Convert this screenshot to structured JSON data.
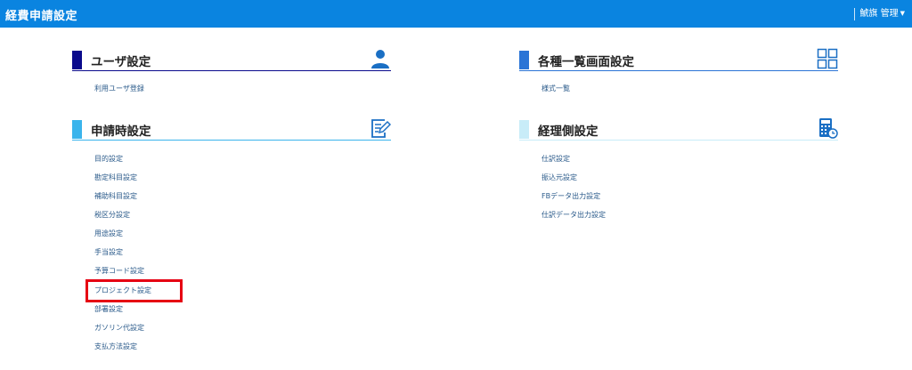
{
  "header": {
    "title": "経費申請設定",
    "user_menu": "鯱旗 管理",
    "bg_color": "#0a84e0"
  },
  "sections": {
    "user": {
      "title": "ユーザ設定",
      "bar_color": "#0a0a8c",
      "icon": "user-icon",
      "items": [
        "利用ユーザ登録"
      ]
    },
    "list": {
      "title": "各種一覧画面設定",
      "bar_color": "#2a74d6",
      "icon": "grid-icon",
      "items": [
        "様式一覧"
      ]
    },
    "apply": {
      "title": "申請時設定",
      "bar_color": "#3ab4ec",
      "icon": "edit-document-icon",
      "items": [
        "目的設定",
        "勘定科目設定",
        "補助科目設定",
        "税区分設定",
        "用途設定",
        "手当設定",
        "予算コード設定",
        "プロジェクト設定",
        "部署設定",
        "ガソリン代設定",
        "支払方法設定"
      ],
      "highlighted_item": "プロジェクト設定"
    },
    "accounting": {
      "title": "経理側設定",
      "bar_color": "#c8ecf8",
      "icon": "calculator-icon",
      "items": [
        "仕訳設定",
        "振込元設定",
        "FBデータ出力設定",
        "仕訳データ出力設定"
      ]
    }
  },
  "colors": {
    "link": "#2a5a8a",
    "highlight_border": "#e60012"
  }
}
